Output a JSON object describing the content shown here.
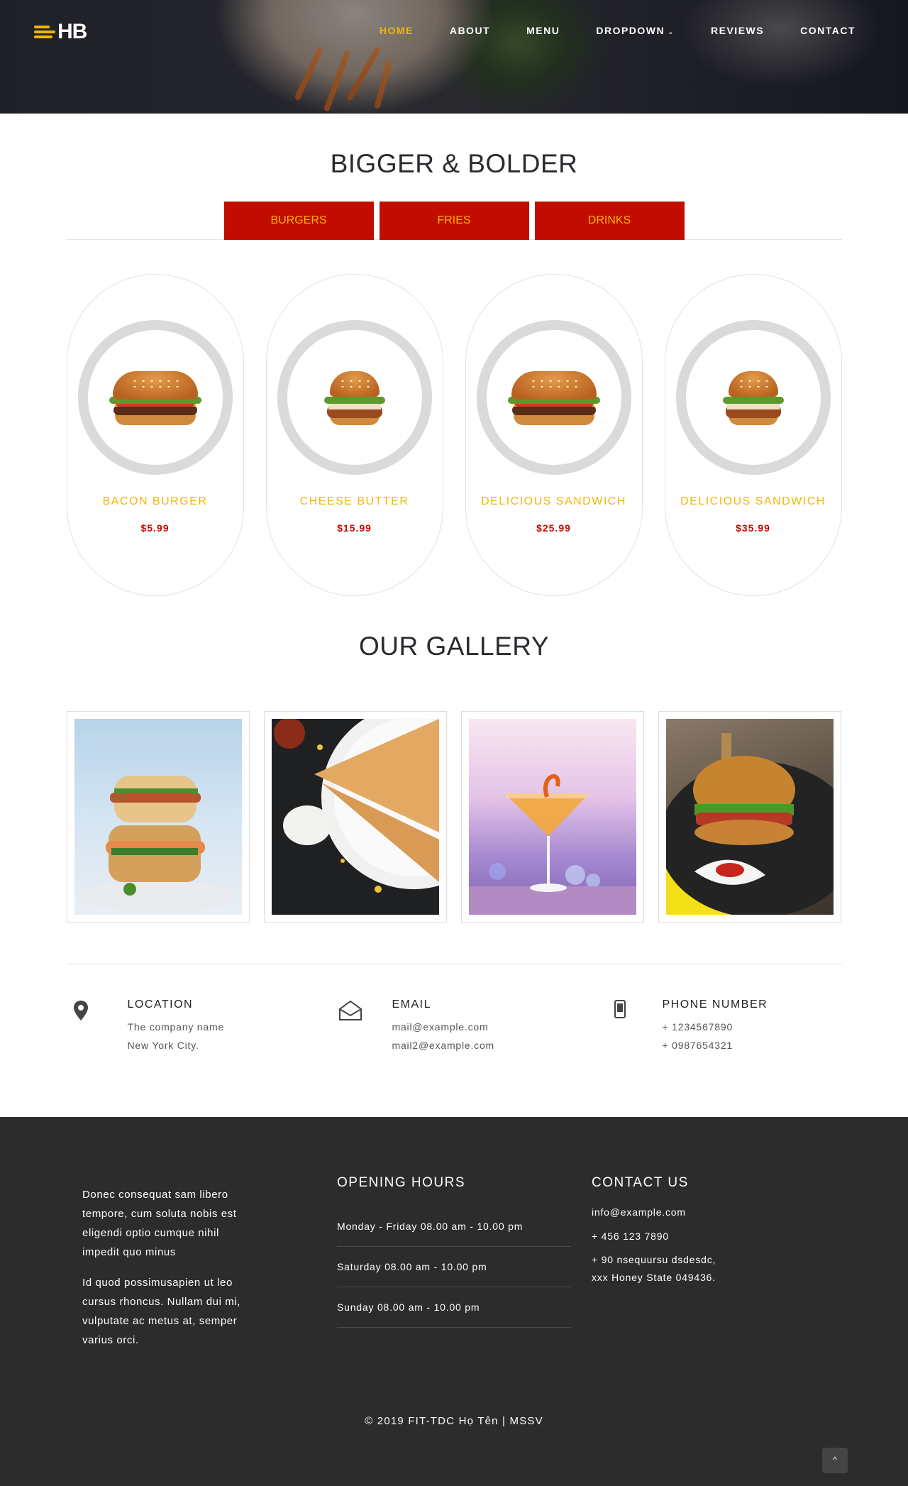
{
  "header": {
    "logo_text": "HB",
    "nav": [
      {
        "label": "HOME",
        "active": true
      },
      {
        "label": "ABOUT",
        "active": false
      },
      {
        "label": "MENU",
        "active": false
      },
      {
        "label": "DROPDOWN",
        "active": false
      },
      {
        "label": "REVIEWS",
        "active": false
      },
      {
        "label": "CONTACT",
        "active": false
      }
    ],
    "dropdown_caret": "⌄"
  },
  "menu_section": {
    "title": "BIGGER & BOLDER",
    "tabs": [
      "BURGERS",
      "FRIES",
      "DRINKS"
    ],
    "products": [
      {
        "name": "BACON BURGER",
        "price": "$5.99"
      },
      {
        "name": "CHEESE BUTTER",
        "price": "$15.99"
      },
      {
        "name": "DELICIOUS SANDWICH",
        "price": "$25.99"
      },
      {
        "name": "DELICIOUS SANDWICH",
        "price": "$35.99"
      }
    ]
  },
  "gallery_section": {
    "title": "OUR GALLERY"
  },
  "contact_info": {
    "location": {
      "title": "LOCATION",
      "line1": "The company name",
      "line2": "New York City."
    },
    "email": {
      "title": "EMAIL",
      "line1": "mail@example.com",
      "line2": "mail2@example.com"
    },
    "phone": {
      "title": "PHONE NUMBER",
      "line1": "+ 1234567890",
      "line2": "+ 0987654321"
    }
  },
  "footer": {
    "para1": "Donec consequat sam libero tempore, cum soluta nobis est eligendi optio cumque nihil impedit quo minus",
    "para2": "Id quod possimusapien ut leo cursus rhoncus. Nullam dui mi, vulputate ac metus at, semper varius orci.",
    "hours_title": "OPENING HOURS",
    "hours": [
      "Monday - Friday 08.00 am - 10.00 pm",
      "Saturday 08.00 am - 10.00 pm",
      "Sunday 08.00 am - 10.00 pm"
    ],
    "contact_title": "CONTACT US",
    "contact_email": "info@example.com",
    "contact_phone": "+ 456 123 7890",
    "contact_addr1": "+ 90 nsequursu dsdesdc,",
    "contact_addr2": "xxx Honey State 049436.",
    "copyright": "© 2019 FIT-TDC Họ Tên | MSSV",
    "to_top": "^"
  },
  "colors": {
    "accent": "#f2b705",
    "brand_red": "#c20c00",
    "footer_bg": "#2c2c2d"
  }
}
